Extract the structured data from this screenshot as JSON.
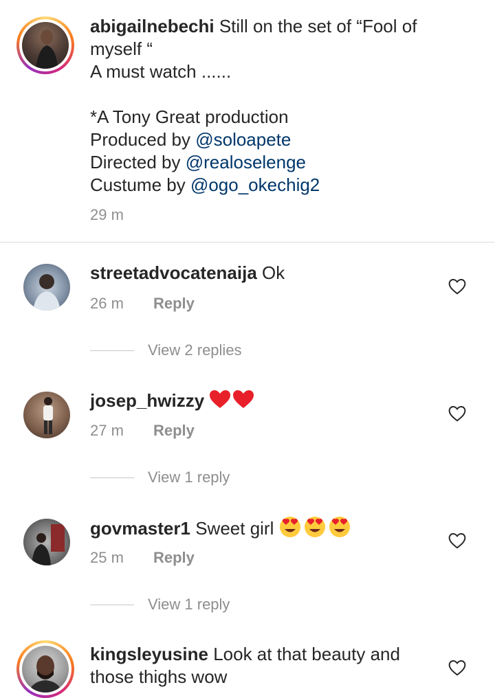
{
  "caption": {
    "username": "abigailnebechi",
    "line1": "Still on the set of “Fool of",
    "line2": "myself “",
    "line3": "A must watch ......",
    "line4": "*A Tony Great production",
    "produced_prefix": "Produced by ",
    "produced_mention": "@soloapete",
    "directed_prefix": "Directed by ",
    "directed_mention": "@realoselenge",
    "costume_prefix": "Custume by ",
    "costume_mention": "@ogo_okechig2",
    "time": "29 m"
  },
  "comments": [
    {
      "username": "streetadvocatenaija",
      "text": "Ok",
      "time": "26 m",
      "reply_label": "Reply",
      "view_replies": "View 2 replies"
    },
    {
      "username": "josep_hwizzy",
      "text": "",
      "emoji": "red-heart",
      "time": "27 m",
      "reply_label": "Reply",
      "view_replies": "View 1 reply"
    },
    {
      "username": "govmaster1",
      "text": "Sweet girl",
      "emoji": "heart-eyes",
      "time": "25 m",
      "reply_label": "Reply",
      "view_replies": "View 1 reply"
    },
    {
      "username": "kingsleyusine",
      "text_line1": "Look at that beauty and",
      "text_line2": "those thighs wow"
    }
  ],
  "colors": {
    "text": "#262626",
    "secondary": "#8e8e8e",
    "mention": "#00376b",
    "heart_red": "#e8202a",
    "emoji_yellow": "#ffcb3d"
  }
}
